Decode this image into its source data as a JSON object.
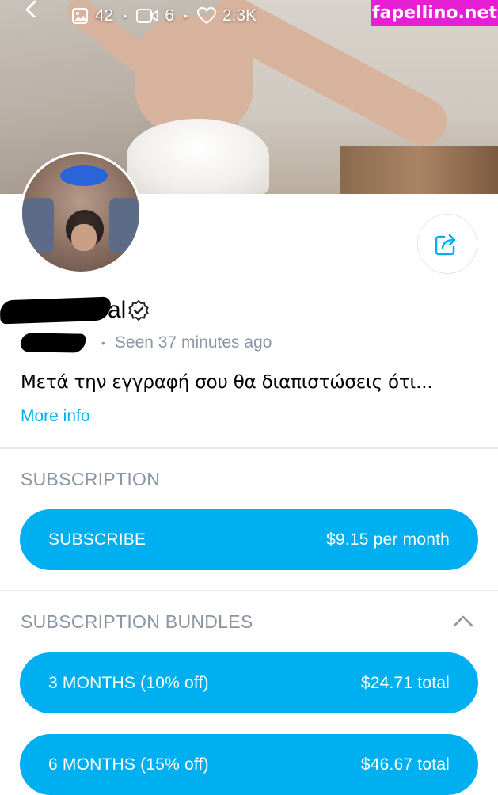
{
  "banner": {
    "photos_count": "42",
    "videos_count": "6",
    "likes_count": "2.3K",
    "separator": "•"
  },
  "watermark": "fapellino.net",
  "profile": {
    "name_visible_tail": "al",
    "last_seen": "Seen 37 minutes ago",
    "bio": "Μετά την εγγραφή σου θα διαπιστώσεις ότι...",
    "more_info": "More info"
  },
  "subscription": {
    "title": "SUBSCRIPTION",
    "button_label": "SUBSCRIBE",
    "button_price": "$9.15 per month"
  },
  "bundles": {
    "title": "SUBSCRIPTION BUNDLES",
    "items": [
      {
        "label": "3 MONTHS (10% off)",
        "price": "$24.71 total"
      },
      {
        "label": "6 MONTHS (15% off)",
        "price": "$46.67 total"
      }
    ]
  },
  "colors": {
    "accent": "#00aff0",
    "muted_text": "#8a96a3",
    "watermark_bg": "#e61fd5"
  },
  "icons": [
    "back-arrow-icon",
    "image-icon",
    "video-icon",
    "heart-icon",
    "share-icon",
    "verified-icon",
    "chevron-up-icon"
  ]
}
